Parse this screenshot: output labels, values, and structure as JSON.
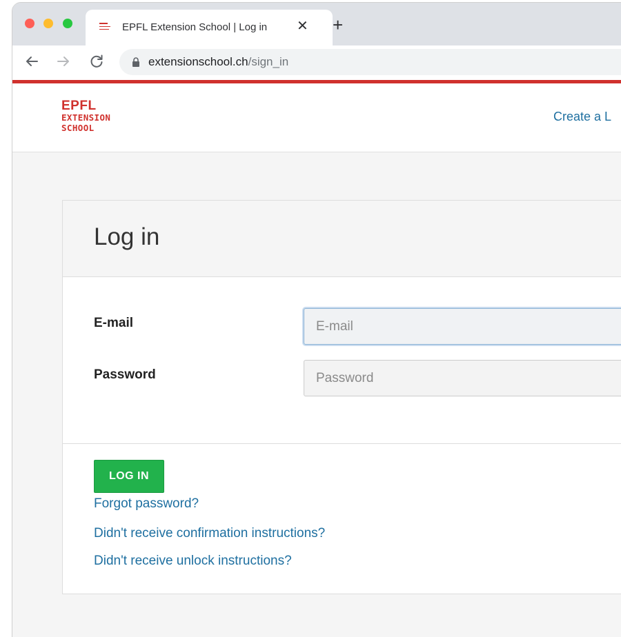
{
  "browser": {
    "tab": {
      "title": "EPFL Extension School | Log in",
      "close_glyph": "✕",
      "favicon": "epfl-favicon-icon"
    },
    "new_tab_glyph": "+",
    "toolbar": {
      "back_icon": "arrow-left-icon",
      "forward_icon": "arrow-right-icon",
      "reload_icon": "reload-icon",
      "lock_icon": "lock-icon"
    },
    "address": {
      "host": "extensionschool.ch",
      "path": "/sign_in"
    }
  },
  "site": {
    "logo": {
      "line1": "EPFL",
      "line2": "EXTENSION",
      "line3": "SCHOOL"
    },
    "header_link": "Create a L",
    "brand_color": "#d0312d",
    "link_color": "#1e6fa0"
  },
  "login": {
    "title": "Log in",
    "email_label": "E-mail",
    "email_placeholder": "E-mail",
    "password_label": "Password",
    "password_placeholder": "Password",
    "submit_label": "LOG IN",
    "submit_color": "#22b24c",
    "links": {
      "forgot": "Forgot password?",
      "confirmation": "Didn't receive confirmation instructions?",
      "unlock": "Didn't receive unlock instructions?"
    }
  }
}
